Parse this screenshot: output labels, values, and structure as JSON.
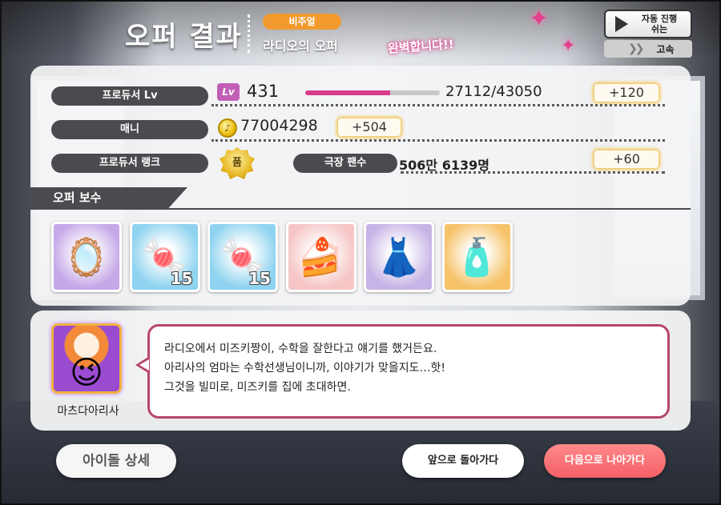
{
  "header": {
    "title": "오퍼 결과",
    "type_badge": "비주얼",
    "offer_name": "라디오의 오퍼",
    "result_text": "완벽합니다!!",
    "auto_play_label": "자동 진행\n쉬는",
    "speed_label": "고속"
  },
  "stats": {
    "producer_lv_label": "프로듀서 Lv",
    "lv_icon_text": "Lv",
    "level": "431",
    "exp_text": "27112/43050",
    "exp_progress": 0.63,
    "exp_gain": "+120",
    "money_label": "매니",
    "money": "77004298",
    "money_gain": "+504",
    "rank_label": "프로듀서 랭크",
    "rank_icon_text": "품",
    "fans_label": "극장 팬수",
    "fans": "506만 6139명",
    "fans_gain": "+60"
  },
  "rewards": {
    "heading": "오퍼 보수",
    "items": [
      {
        "name": "hand-mirror",
        "icon": "🪞",
        "bg": "#c5a8e8",
        "count": ""
      },
      {
        "name": "pink-macarons",
        "icon": "🍬",
        "bg": "#8fd3f0",
        "count": "15"
      },
      {
        "name": "pink-macarons",
        "icon": "🍬",
        "bg": "#8fd3f0",
        "count": "15"
      },
      {
        "name": "roll-cake",
        "icon": "🍰",
        "bg": "#f6c6c6",
        "count": ""
      },
      {
        "name": "white-dress",
        "icon": "👗",
        "bg": "#c7b4e6",
        "count": ""
      },
      {
        "name": "cosmetics",
        "icon": "🧴",
        "bg": "#f6c36a",
        "count": ""
      }
    ]
  },
  "dialogue": {
    "character_name": "마츠다아리사",
    "lines": [
      "라디오에서 미즈키짱이, 수학을 잘한다고 얘기를 했거든요.",
      "아리사의 엄마는 수학선생님이니까, 이야기가 맞을지도…핫!",
      "그것을 빌미로, 미즈키를 집에 초대하면."
    ]
  },
  "buttons": {
    "idol_detail": "아이돌 상세",
    "go_back": "앞으로 돌아가다",
    "go_next": "다음으로 나아가다"
  },
  "colors": {
    "accent_pink": "#d83b8a",
    "badge_orange": "#f29a2e",
    "next_button": "#f46067",
    "speech_border": "#b8476a"
  }
}
